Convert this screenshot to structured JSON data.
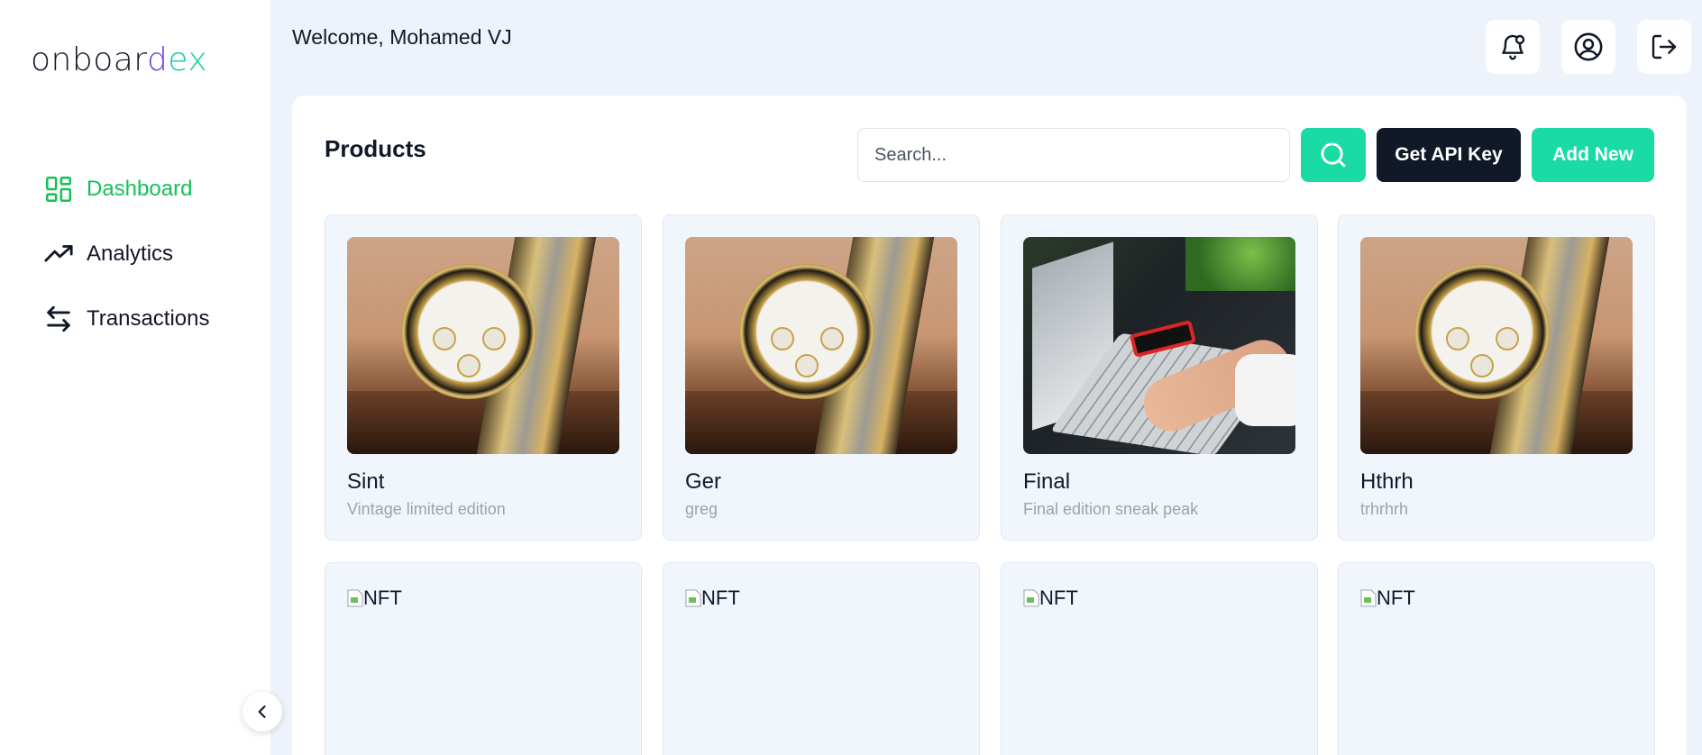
{
  "logo": {
    "part1": "onboar",
    "part2": "d",
    "part3": "e",
    "part4": "x"
  },
  "sidebar": {
    "items": [
      {
        "label": "Dashboard",
        "icon": "dashboard-grid-icon",
        "active": true
      },
      {
        "label": "Analytics",
        "icon": "trending-up-icon",
        "active": false
      },
      {
        "label": "Transactions",
        "icon": "swap-arrows-icon",
        "active": false
      }
    ]
  },
  "header": {
    "welcome": "Welcome, Mohamed VJ"
  },
  "panel": {
    "title": "Products",
    "search_placeholder": "Search...",
    "api_key_label": "Get API Key",
    "add_new_label": "Add New"
  },
  "products": [
    {
      "name": "Sint",
      "description": "Vintage limited edition",
      "image": "watch"
    },
    {
      "name": "Ger",
      "description": "greg",
      "image": "watch"
    },
    {
      "name": "Final",
      "description": "Final edition sneak peak",
      "image": "laptop"
    },
    {
      "name": "Hthrh",
      "description": "trhrhrh",
      "image": "watch"
    }
  ],
  "broken_products": [
    {
      "alt": "NFT"
    },
    {
      "alt": "NFT"
    },
    {
      "alt": "NFT"
    },
    {
      "alt": "NFT"
    }
  ],
  "colors": {
    "accent": "#19dba3",
    "active_nav": "#16c15a",
    "dark_button": "#111827"
  }
}
